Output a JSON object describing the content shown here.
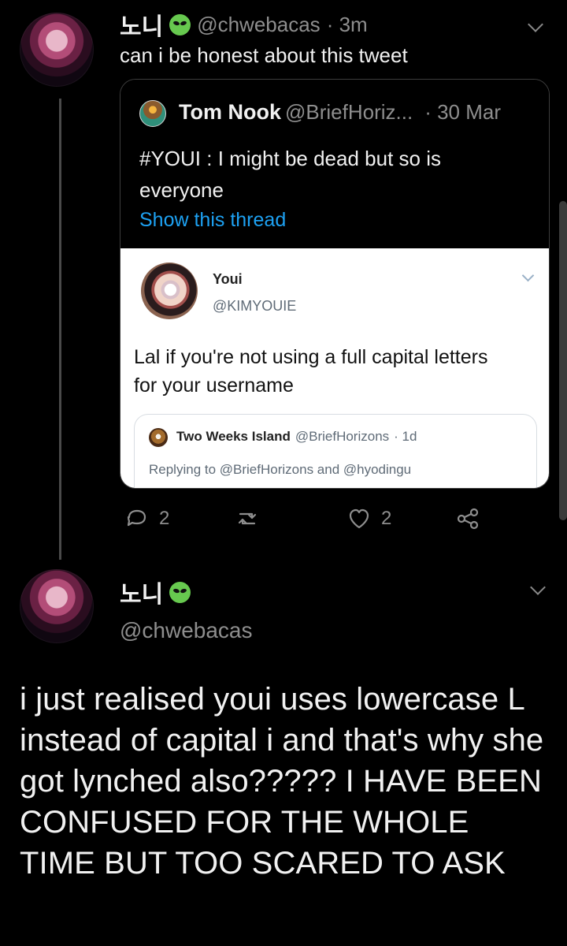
{
  "first_tweet": {
    "name": "노니",
    "handle": "@chwebacas",
    "time": "· 3m",
    "text": "can i be honest about this tweet"
  },
  "quoted_tweet": {
    "name": "Tom Nook",
    "handle": "@BriefHoriz...",
    "time": "· 30 Mar",
    "text": "#YOUI : I might be dead but so is everyone",
    "show_thread": "Show this thread"
  },
  "embedded_screenshot": {
    "name": "Youi",
    "handle": "@KIMYOUIE",
    "text": "Lal if you're not using a full capital letters for your username",
    "inner_card": {
      "name": "Two Weeks Island",
      "handle": "@BriefHorizons",
      "time": "· 1d",
      "reply_text": "Replying to @BriefHorizons and @hyodingu"
    }
  },
  "actions": {
    "reply_count": "2",
    "like_count": "2"
  },
  "second_tweet": {
    "name": "노니",
    "handle": "@chwebacas",
    "text": "i just realised youi uses lowercase L instead of capital i and that's why she got lynched also????? I HAVE BEEN CONFUSED FOR THE WHOLE TIME BUT TOO SCARED TO ASK"
  },
  "icons": [
    "alien-icon",
    "chevron-down-icon",
    "reply-icon",
    "retweet-icon",
    "heart-icon",
    "share-icon"
  ],
  "colors": {
    "background": "#000000",
    "text": "#e9e9e9",
    "muted": "#8e8e8e",
    "link": "#1da1f2",
    "alien": "#67c94f"
  }
}
